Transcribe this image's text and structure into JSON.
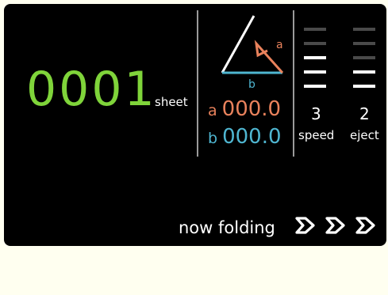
{
  "counter": {
    "value": "0001",
    "unit": "sheet"
  },
  "triangle": {
    "label_a": "a",
    "label_b": "b"
  },
  "measurements": {
    "a": {
      "tag": "a",
      "value": "000.0"
    },
    "b": {
      "tag": "b",
      "value": "000.0"
    }
  },
  "speed": {
    "value": "3",
    "label": "speed",
    "level": 3,
    "max_level": 5
  },
  "eject": {
    "value": "2",
    "label": "eject",
    "level": 2,
    "max_level": 5
  },
  "status": {
    "text": "now folding",
    "indicators": [
      "fold-arrow-icon",
      "fold-arrow-icon",
      "fold-arrow-icon"
    ]
  },
  "colors": {
    "panel": "#000000",
    "background": "#fffff0",
    "counter": "#7fd43a",
    "measure_a": "#e9825c",
    "measure_b": "#4fb6d1",
    "level_on": "#ffffff",
    "level_off": "#4a4a4a"
  }
}
